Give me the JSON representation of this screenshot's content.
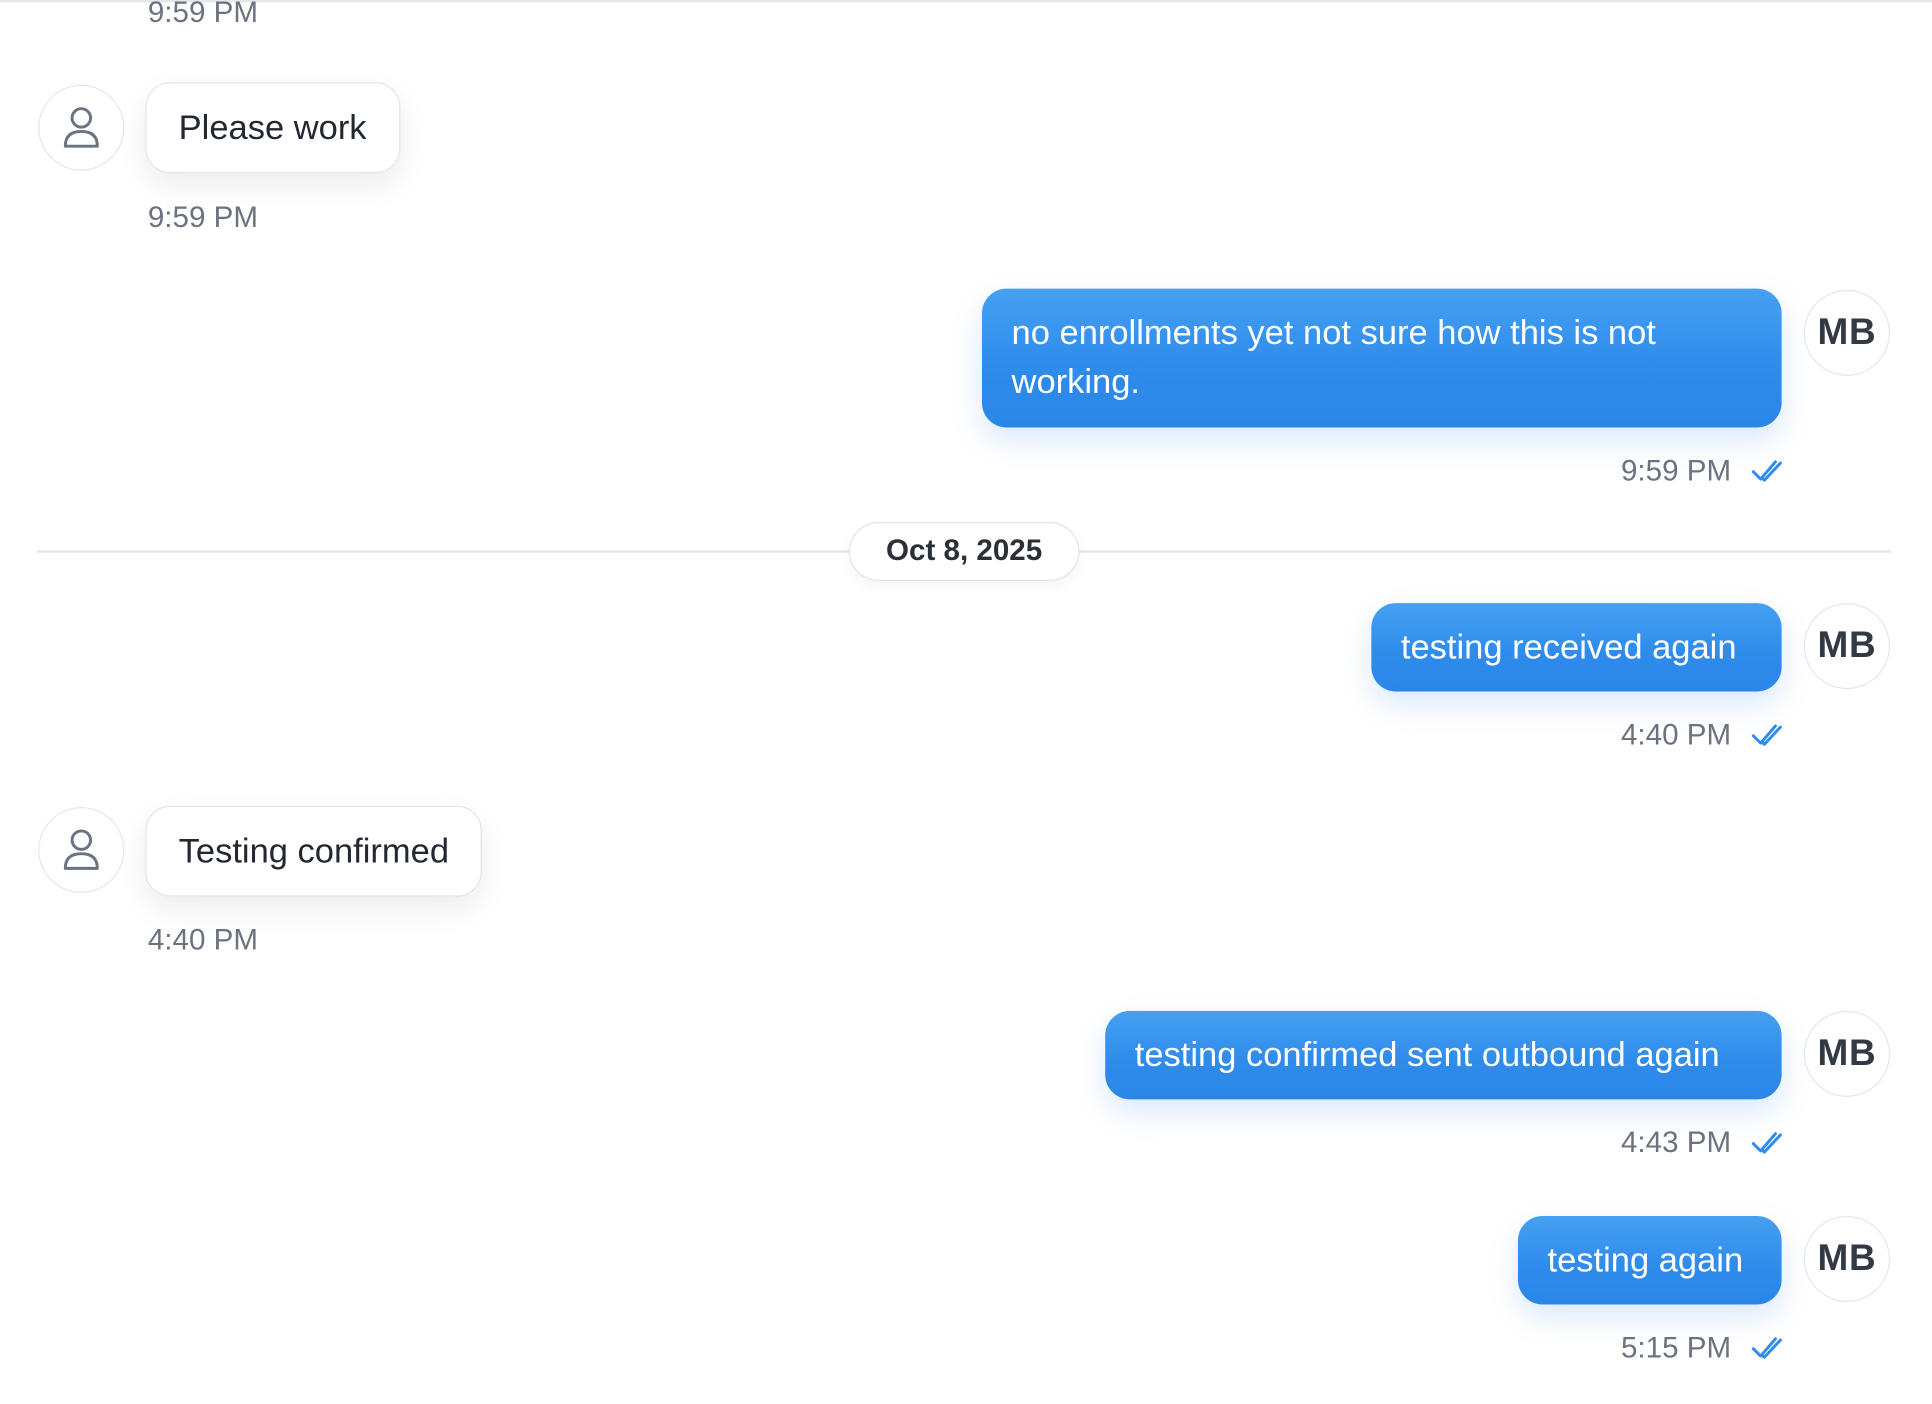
{
  "thread": {
    "top_time": "9:59 PM",
    "date_separator": "Oct 8, 2025",
    "outgoing_avatar_initials": "MB",
    "accent_color": "#2f8ceb",
    "status_icon": "double-check-icon",
    "messages": [
      {
        "direction": "incoming",
        "text": "Please work",
        "time": "9:59 PM"
      },
      {
        "direction": "outgoing",
        "text": "no enrollments yet not sure how this is not working.",
        "time": "9:59 PM"
      },
      {
        "direction": "outgoing",
        "text": "testing received again",
        "time": "4:40 PM"
      },
      {
        "direction": "incoming",
        "text": "Testing confirmed",
        "time": "4:40 PM"
      },
      {
        "direction": "outgoing",
        "text": "testing confirmed sent outbound again",
        "time": "4:43 PM"
      },
      {
        "direction": "outgoing",
        "text": "testing again",
        "time": "5:15 PM"
      }
    ]
  }
}
